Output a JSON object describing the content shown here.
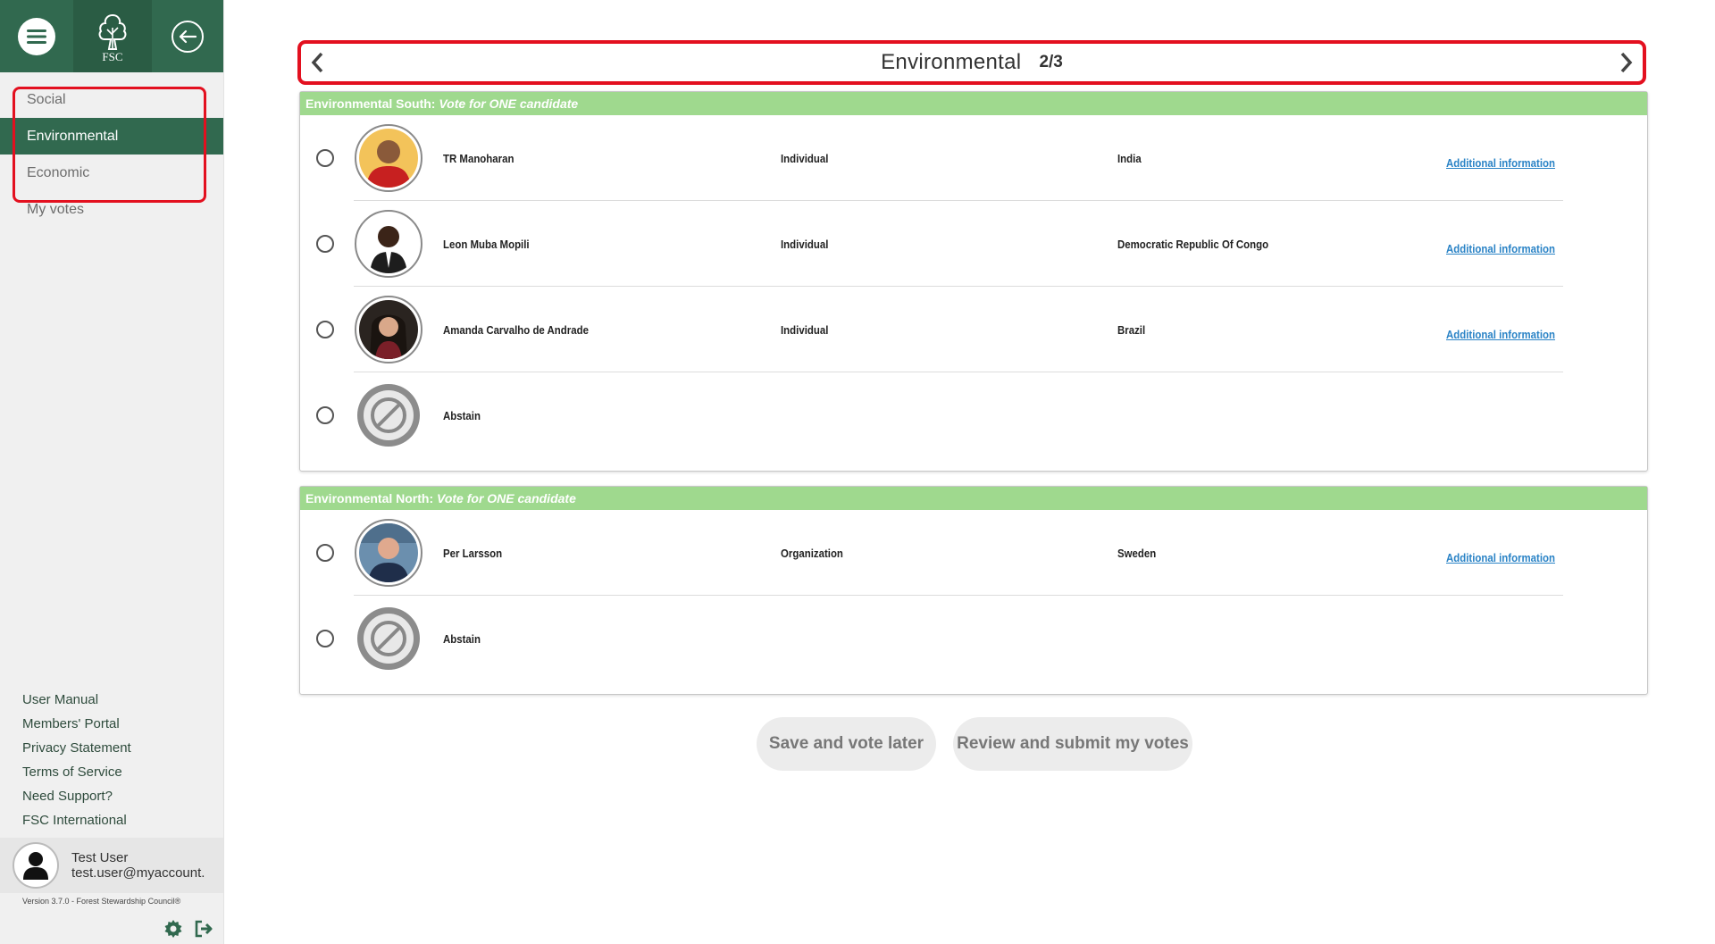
{
  "app": {
    "logo_text": "FSC"
  },
  "sidebar": {
    "items": [
      {
        "label": "Social"
      },
      {
        "label": "Environmental"
      },
      {
        "label": "Economic"
      },
      {
        "label": "My votes"
      }
    ],
    "links": [
      "User Manual",
      "Members' Portal",
      "Privacy Statement",
      "Terms of Service",
      "Need Support?",
      "FSC International"
    ],
    "user": {
      "name": "Test User",
      "email": "test.user@myaccount."
    },
    "version": "Version 3.7.0 - Forest Stewardship Council®"
  },
  "header": {
    "title": "Environmental",
    "count": "2/3"
  },
  "sections": [
    {
      "title": "Environmental South:",
      "instruction": "Vote for ONE candidate",
      "rows": [
        {
          "name": "TR Manoharan",
          "type": "Individual",
          "country": "India",
          "info": "Additional information"
        },
        {
          "name": "Leon Muba Mopili",
          "type": "Individual",
          "country": "Democratic Republic Of Congo",
          "info": "Additional information"
        },
        {
          "name": "Amanda Carvalho de Andrade",
          "type": "Individual",
          "country": "Brazil",
          "info": "Additional information"
        },
        {
          "name": "Abstain"
        }
      ]
    },
    {
      "title": "Environmental North:",
      "instruction": "Vote for ONE candidate",
      "rows": [
        {
          "name": "Per Larsson",
          "type": "Organization",
          "country": "Sweden",
          "info": "Additional information"
        },
        {
          "name": "Abstain"
        }
      ]
    }
  ],
  "buttons": {
    "save": "Save and vote later",
    "review": "Review and submit my votes"
  },
  "colors": {
    "brand_green": "#31694f",
    "section_header": "#9fd98e",
    "highlight_red": "#e3101f",
    "link_blue": "#2a83c6"
  }
}
